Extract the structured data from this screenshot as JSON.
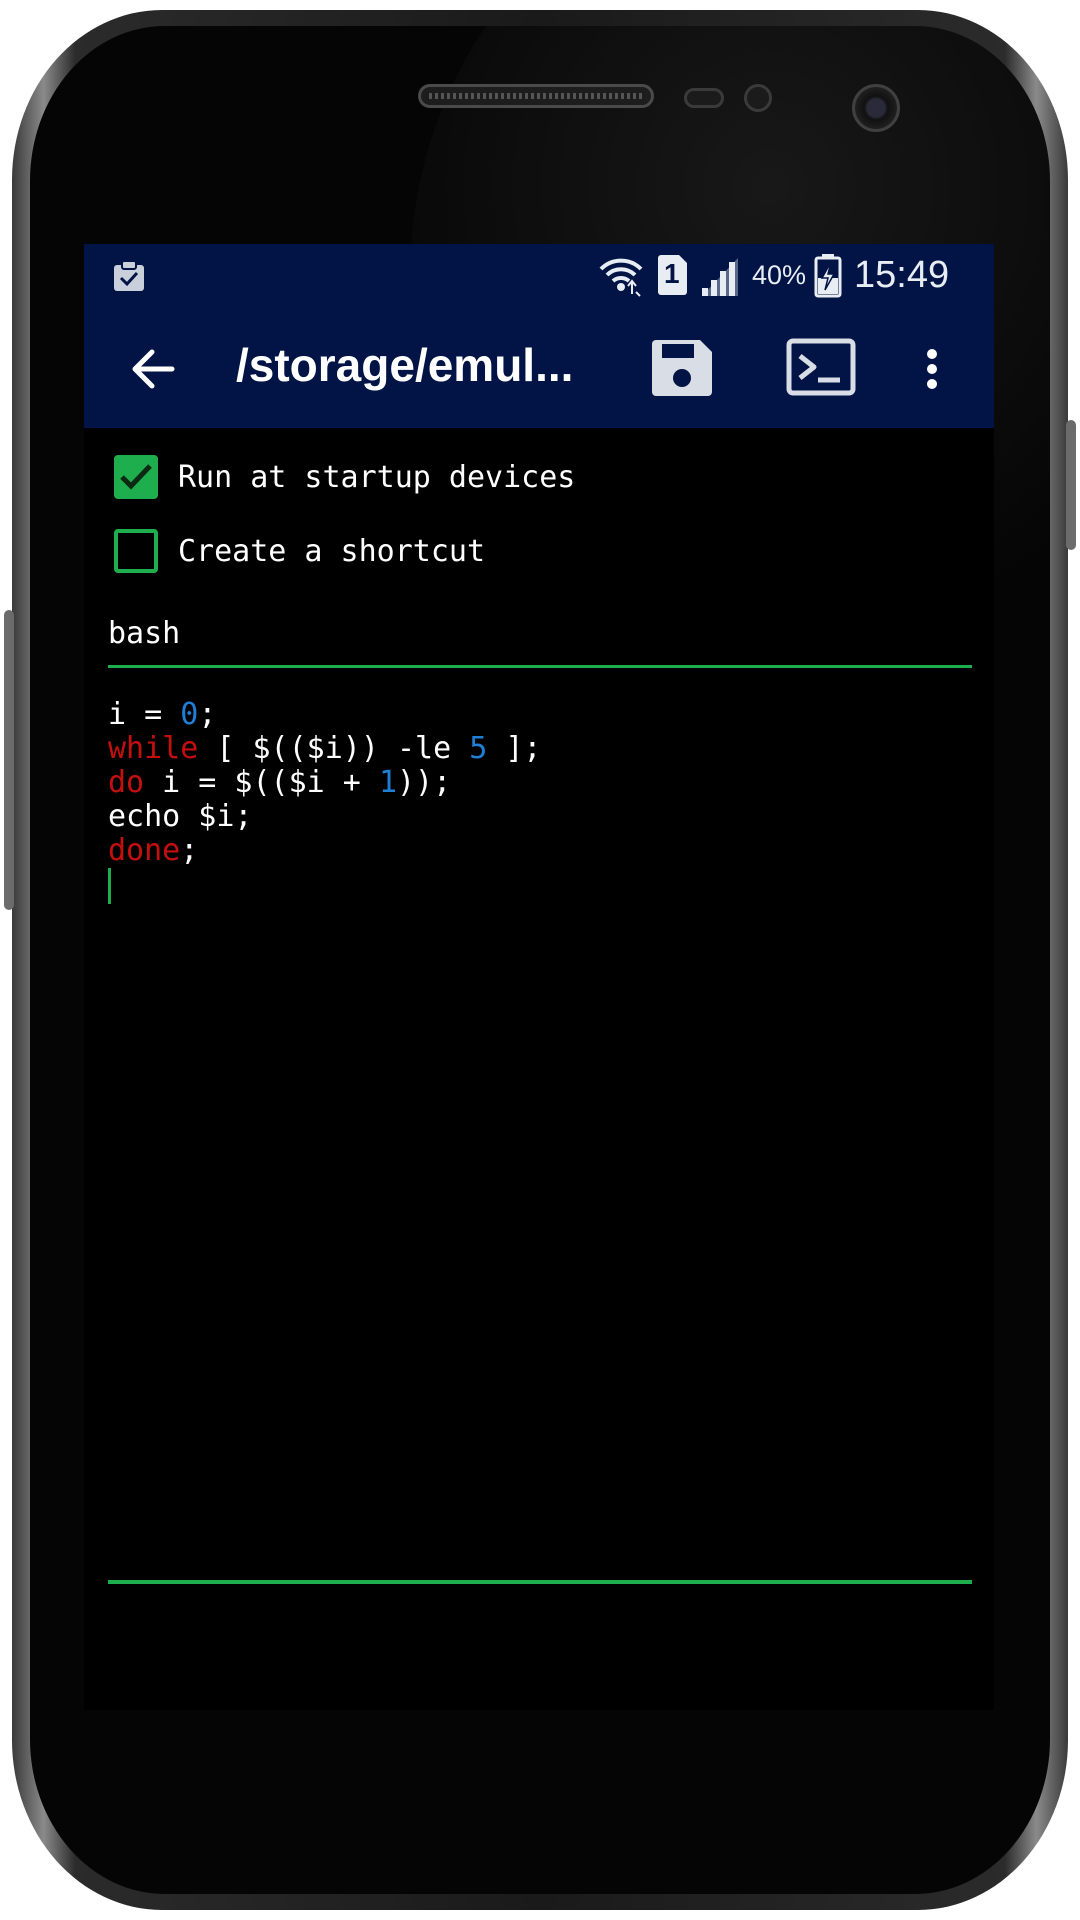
{
  "status_bar": {
    "battery_percent": "40%",
    "time": "15:49",
    "sim_slot": "1",
    "icons": [
      "clipboard-icon",
      "wifi-icon",
      "sim-icon",
      "signal-icon",
      "battery-charging-icon"
    ]
  },
  "app_bar": {
    "title": "/storage/emul...",
    "icons": [
      "back-arrow-icon",
      "save-icon",
      "terminal-icon",
      "more-vert-icon"
    ]
  },
  "options": {
    "run_at_startup_label": "Run at startup devices",
    "run_at_startup_checked": true,
    "create_shortcut_label": "Create a shortcut",
    "create_shortcut_checked": false
  },
  "shell_field": {
    "value": "bash"
  },
  "script": {
    "lines": [
      [
        {
          "t": "i = ",
          "c": "plain"
        },
        {
          "t": "0",
          "c": "num"
        },
        {
          "t": ";",
          "c": "plain"
        }
      ],
      [
        {
          "t": "while",
          "c": "kw"
        },
        {
          "t": " [ $(($i)) -le ",
          "c": "plain"
        },
        {
          "t": "5",
          "c": "num"
        },
        {
          "t": " ];",
          "c": "plain"
        }
      ],
      [
        {
          "t": "do",
          "c": "kw"
        },
        {
          "t": " i = $(($i + ",
          "c": "plain"
        },
        {
          "t": "1",
          "c": "num"
        },
        {
          "t": "));",
          "c": "plain"
        }
      ],
      [
        {
          "t": "echo $i;",
          "c": "plain"
        }
      ],
      [
        {
          "t": "done",
          "c": "kw"
        },
        {
          "t": ";",
          "c": "plain"
        }
      ]
    ]
  },
  "colors": {
    "app_bar": "#011445",
    "accent_green": "#1fae4e",
    "keyword_red": "#c50f0f",
    "number_blue": "#1e7fd6"
  }
}
